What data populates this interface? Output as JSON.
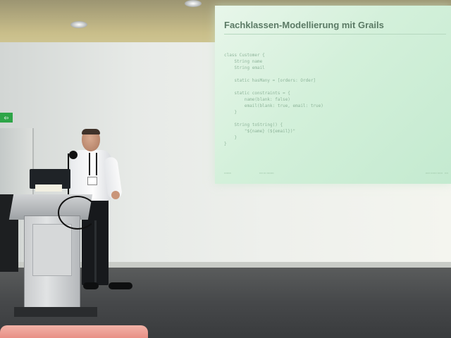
{
  "scene": {
    "description_tag": "",
    "colors": {
      "screen": "#d3f0da",
      "slide_title": "#5b7a65",
      "code": "#8fb59b",
      "ceiling": "#c9be8a",
      "floor": "#46484a",
      "exit_sign": "#2ea548"
    }
  },
  "exit_sign": {
    "label": ""
  },
  "slide": {
    "title": "Fachklassen-Modellierung mit Grails",
    "code_lines": [
      "class Customer {",
      "    String name",
      "    String email",
      "",
      "    static hasMany = [orders: Order]",
      "",
      "    static constraints = {",
      "        name(blank: false)",
      "        email(blank: true, email: true)",
      "    }",
      "",
      "    String toString() {",
      "        \"${name} (${email})\"",
      "    }",
      "}"
    ]
  }
}
